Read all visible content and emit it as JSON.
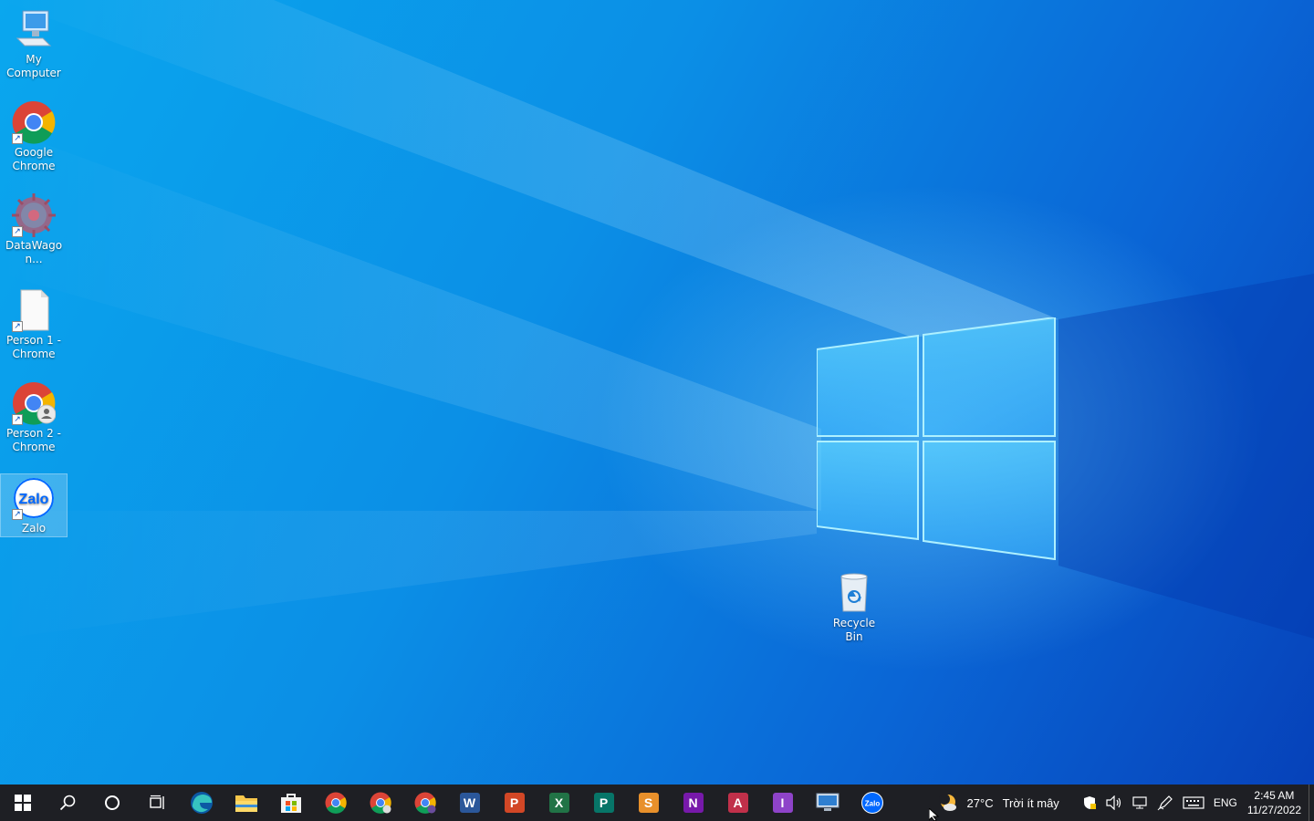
{
  "desktop": {
    "icons": [
      {
        "label": "My Computer",
        "icon": "my-computer-icon"
      },
      {
        "label": "Google Chrome",
        "icon": "chrome-icon"
      },
      {
        "label": "DataWagon...",
        "icon": "datawagon-icon"
      },
      {
        "label": "Person 1 - Chrome",
        "icon": "blank-document-icon"
      },
      {
        "label": "Person 2 - Chrome",
        "icon": "chrome-profile-icon"
      },
      {
        "label": "Zalo",
        "icon": "zalo-icon",
        "selected": true
      }
    ],
    "recycle_bin": {
      "label": "Recycle Bin",
      "icon": "recycle-bin-icon"
    }
  },
  "taskbar": {
    "pinned": [
      "edge-icon",
      "file-explorer-icon",
      "microsoft-store-icon",
      "chrome-icon",
      "chrome-profile-icon",
      "chrome-profile-icon",
      "word-icon",
      "powerpoint-icon",
      "excel-icon",
      "publisher-icon",
      "sway-icon",
      "onenote-icon",
      "access-icon",
      "infopath-icon",
      "remote-desktop-icon",
      "zalo-icon"
    ],
    "tile_letters": {
      "word": "W",
      "powerpoint": "P",
      "excel": "X",
      "publisher": "P",
      "sway": "S",
      "onenote": "N",
      "access": "A",
      "infopath": "I",
      "zalo": "Zalo"
    },
    "weather": {
      "temp": "27°C",
      "desc": "Trời ít mây"
    },
    "language": "ENG",
    "time": "2:45 AM",
    "date": "11/27/2022"
  },
  "colors": {
    "taskbar": "#1e1f24",
    "desktop_accent": "#0a8fe6"
  }
}
